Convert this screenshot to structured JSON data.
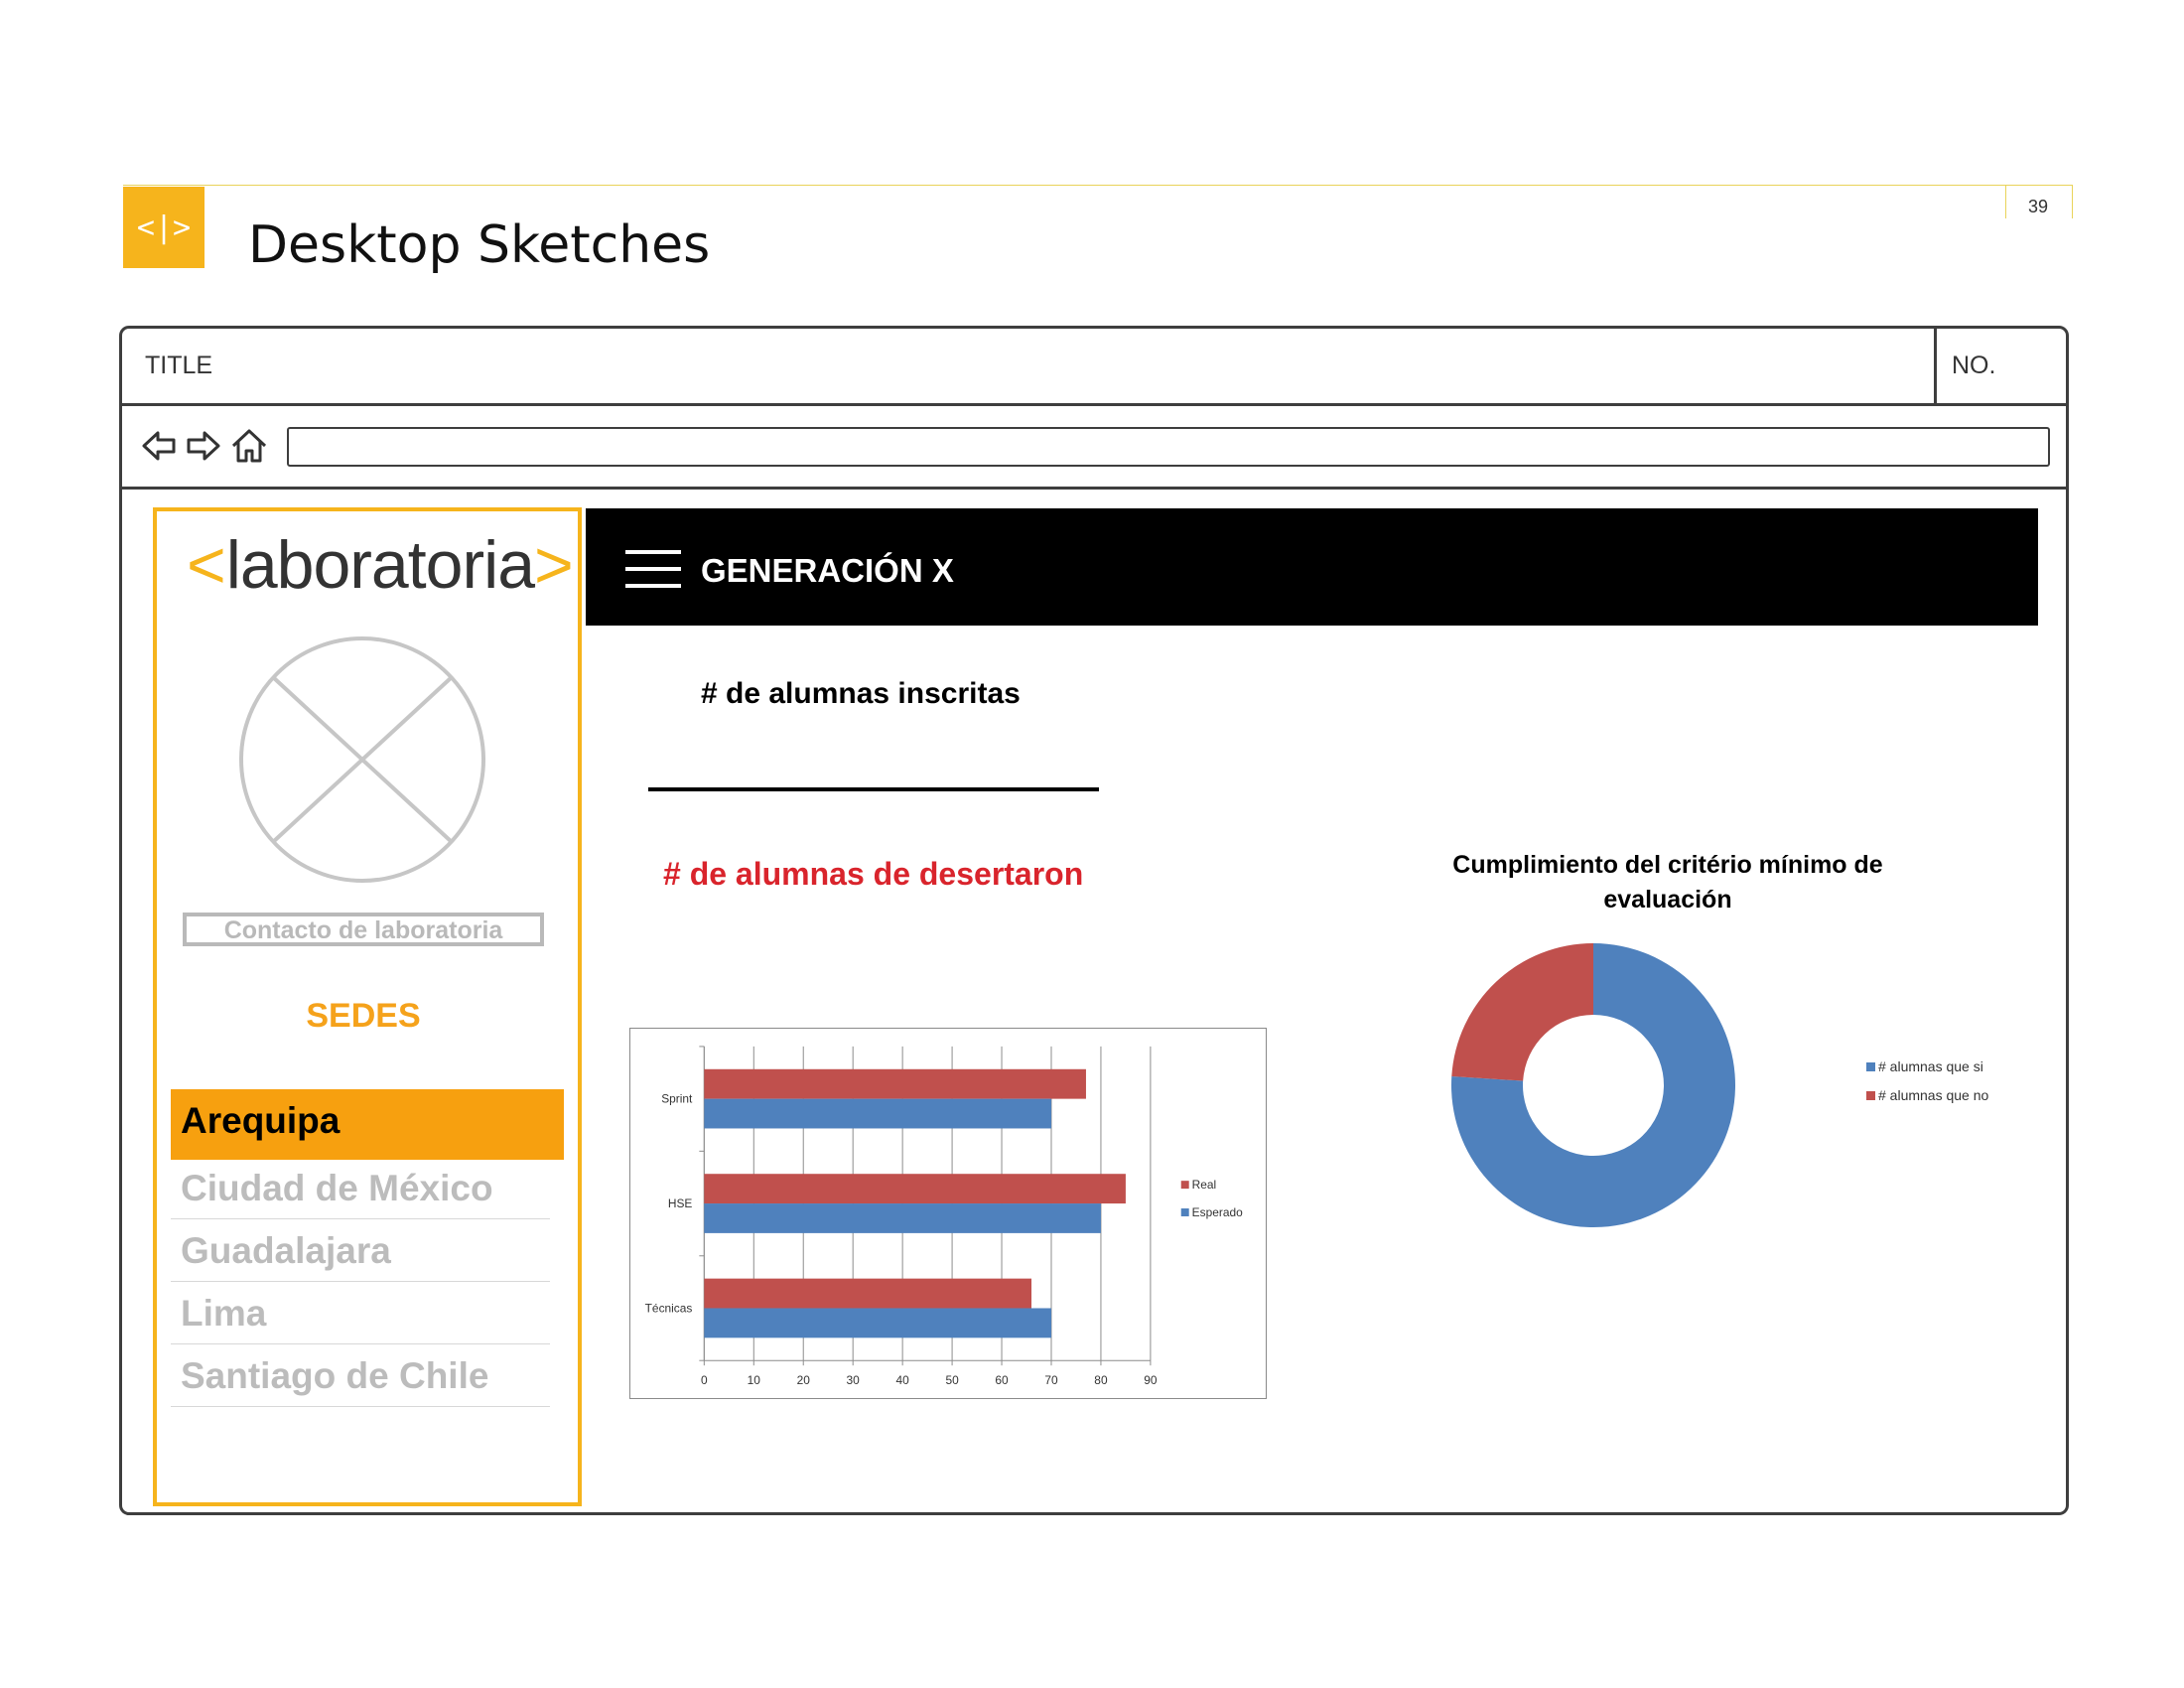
{
  "slide": {
    "badge": "<|>",
    "title": "Desktop Sketches",
    "page_number": "39"
  },
  "window": {
    "title": "TITLE",
    "number": "NO."
  },
  "toolbar": {
    "back_icon": "back-arrow-icon",
    "forward_icon": "forward-arrow-icon",
    "home_icon": "home-icon",
    "address_value": ""
  },
  "sidebar": {
    "logo": {
      "open": "<",
      "name": "laboratoria",
      "close": ">"
    },
    "avatar_icon": "avatar-placeholder-icon",
    "contact_label": "Contacto de laboratoria",
    "sedes_title": "SEDES",
    "sedes": [
      {
        "label": "Arequipa",
        "active": true
      },
      {
        "label": "Ciudad de México",
        "active": false
      },
      {
        "label": "Guadalajara",
        "active": false
      },
      {
        "label": "Lima",
        "active": false
      },
      {
        "label": "Santiago de Chile",
        "active": false
      }
    ]
  },
  "header": {
    "menu_icon": "hamburger-menu-icon",
    "title": "GENERACIÓN X"
  },
  "main": {
    "enrolled_label": "# de alumnas inscritas",
    "enrolled_value": "",
    "dropout_label": "# de alumnas de desertaron"
  },
  "colors": {
    "accent": "#f6b41c",
    "active_sede": "#f7a00f",
    "sedes_title": "#f5a21b",
    "dropout": "#d9242c",
    "real": "#c0504d",
    "esperado": "#4f81bd",
    "inactive_text": "#bcbcbc"
  },
  "chart_data": [
    {
      "type": "bar",
      "orientation": "horizontal",
      "categories": [
        "Sprint",
        "HSE",
        "Técnicas"
      ],
      "series": [
        {
          "name": "Real",
          "values": [
            77,
            85,
            66
          ],
          "color": "#c0504d"
        },
        {
          "name": "Esperado",
          "values": [
            70,
            80,
            70
          ],
          "color": "#4f81bd"
        }
      ],
      "xlim": [
        0,
        90
      ],
      "xticks": [
        0,
        10,
        20,
        30,
        40,
        50,
        60,
        70,
        80,
        90
      ],
      "grid": true,
      "legend": "right"
    },
    {
      "type": "pie",
      "donut": true,
      "title": "Cumplimiento del critério mínimo de evaluación",
      "categories": [
        "# alumnas que si",
        "# alumnas que no"
      ],
      "values": [
        76,
        24
      ],
      "colors": [
        "#4f81bd",
        "#c0504d"
      ],
      "legend": "right"
    }
  ]
}
